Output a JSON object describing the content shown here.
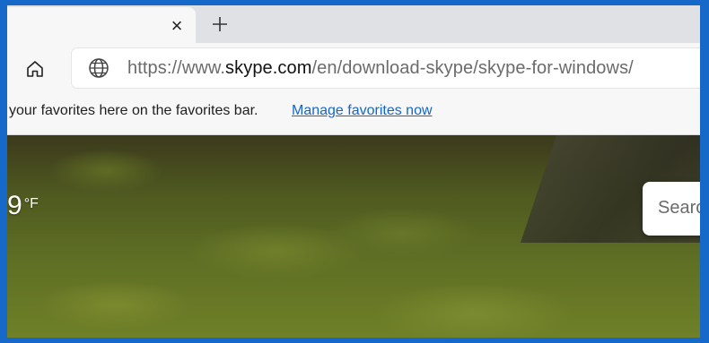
{
  "tab": {
    "close_glyph": "×",
    "new_tab_icon": "plus-icon"
  },
  "toolbar": {
    "home_icon": "home-icon",
    "site_icon": "globe-icon",
    "url_prefix": "https://www.",
    "url_domain": "skype.com",
    "url_path": "/en/download-skype/skype-for-windows/"
  },
  "favorites_bar": {
    "message": "your favorites here on the favorites bar.",
    "link_label": "Manage favorites now"
  },
  "page": {
    "weather_temp": "9",
    "weather_unit": "°F",
    "search_placeholder": "Searc"
  },
  "colors": {
    "window_border": "#1669c9",
    "link": "#1467c9"
  }
}
